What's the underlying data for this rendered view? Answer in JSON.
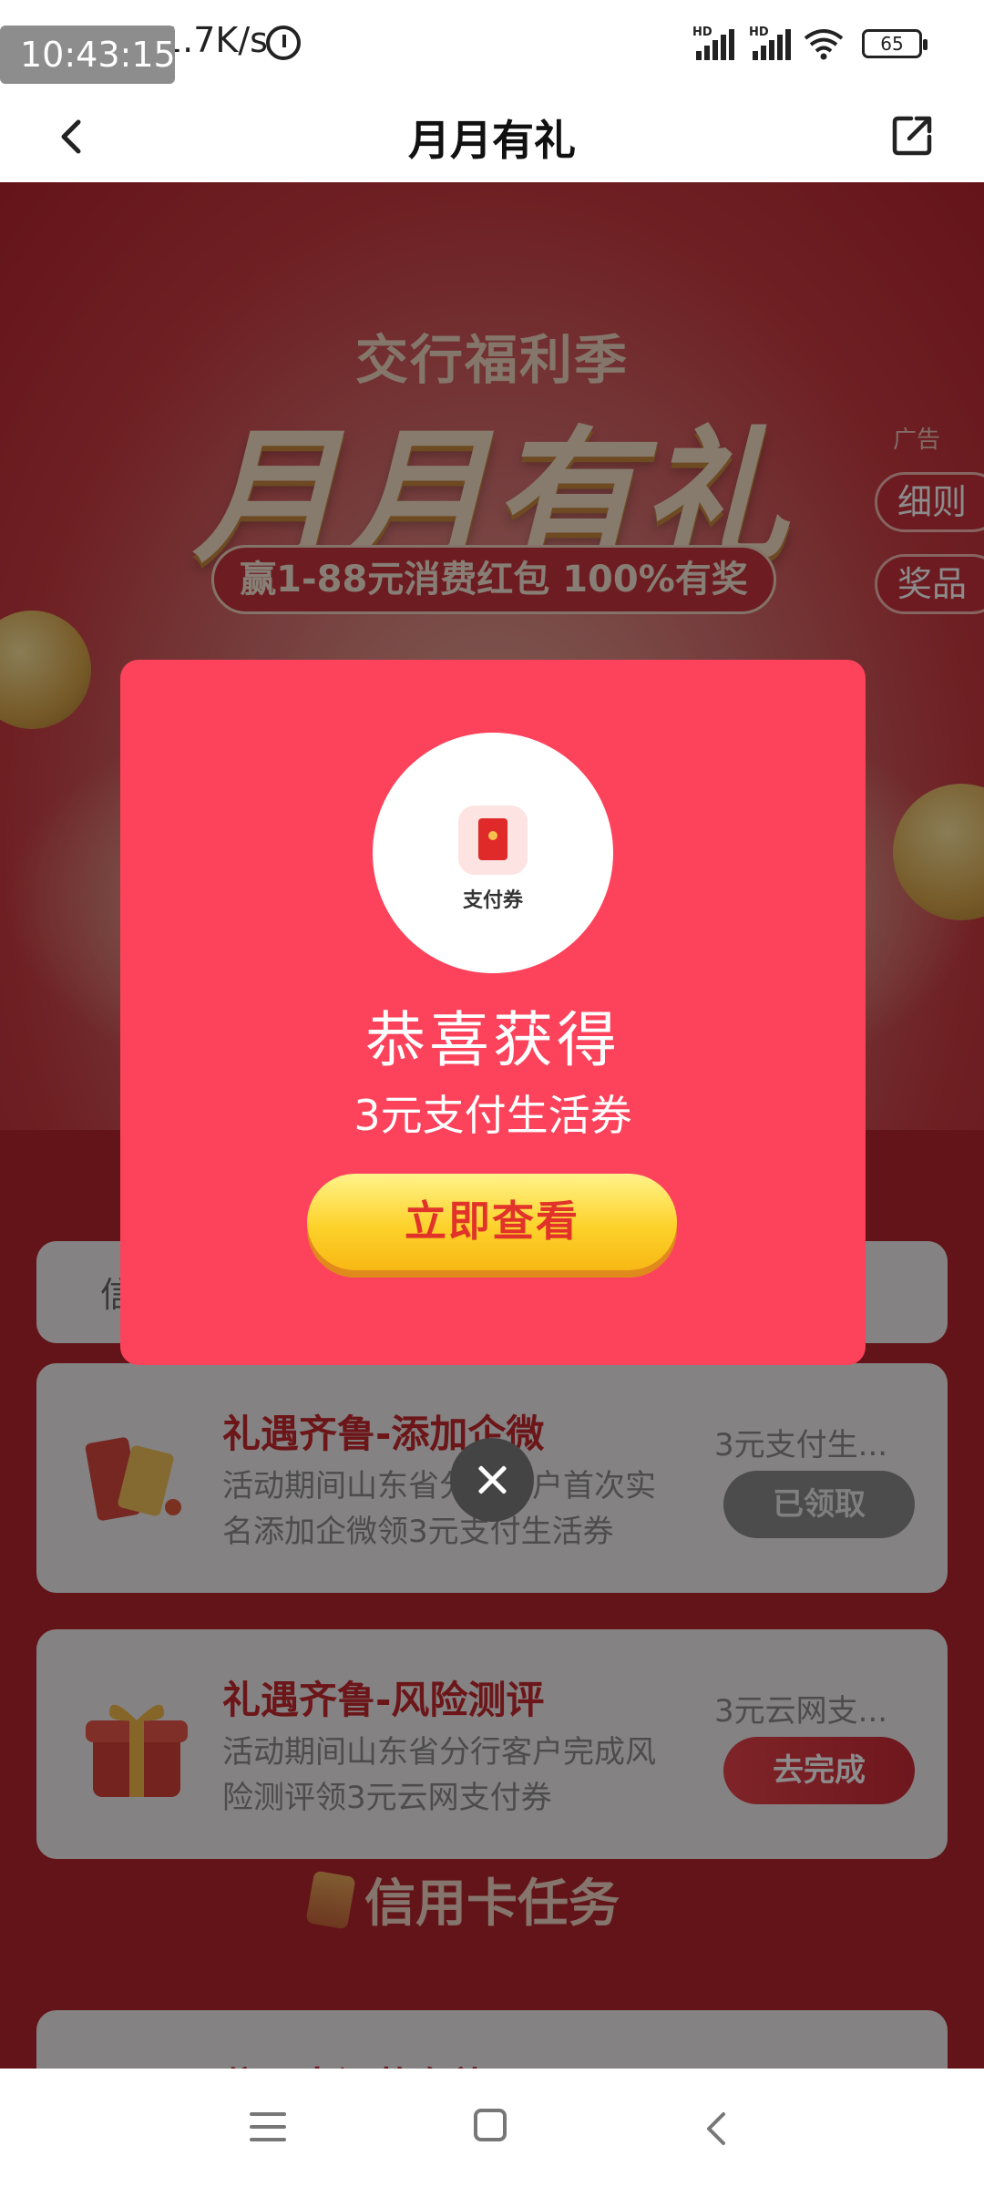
{
  "status_bar": {
    "time": "10:43:15",
    "speed": "1.7K/s",
    "battery": "65",
    "signal_label": "HD"
  },
  "title_bar": {
    "title": "月月有礼"
  },
  "banner": {
    "subtitle": "交行福利季",
    "main_title": "月月有礼",
    "tagline": "赢1-88元消费红包 100%有奖",
    "ad_label": "广告",
    "side_tabs": [
      "细则",
      "奖品"
    ]
  },
  "mini_card": {
    "text": "信"
  },
  "tasks": [
    {
      "title": "礼遇齐鲁-添加企微",
      "desc": "活动期间山东省分行客户首次实名添加企微领3元支付生活券",
      "reward": "3元支付生...",
      "button": "已领取"
    },
    {
      "title": "礼遇齐鲁-风险测评",
      "desc": "活动期间山东省分行客户完成风险测评领3元云网支付券",
      "reward": "3元云网支...",
      "button": "去完成"
    }
  ],
  "section": {
    "title": "信用卡任务"
  },
  "partial_card": {
    "title": "信用卡还款有礼"
  },
  "dialog": {
    "prize_label": "支付券",
    "title": "恭喜获得",
    "subtitle": "3元支付生活券",
    "button": "立即查看"
  }
}
